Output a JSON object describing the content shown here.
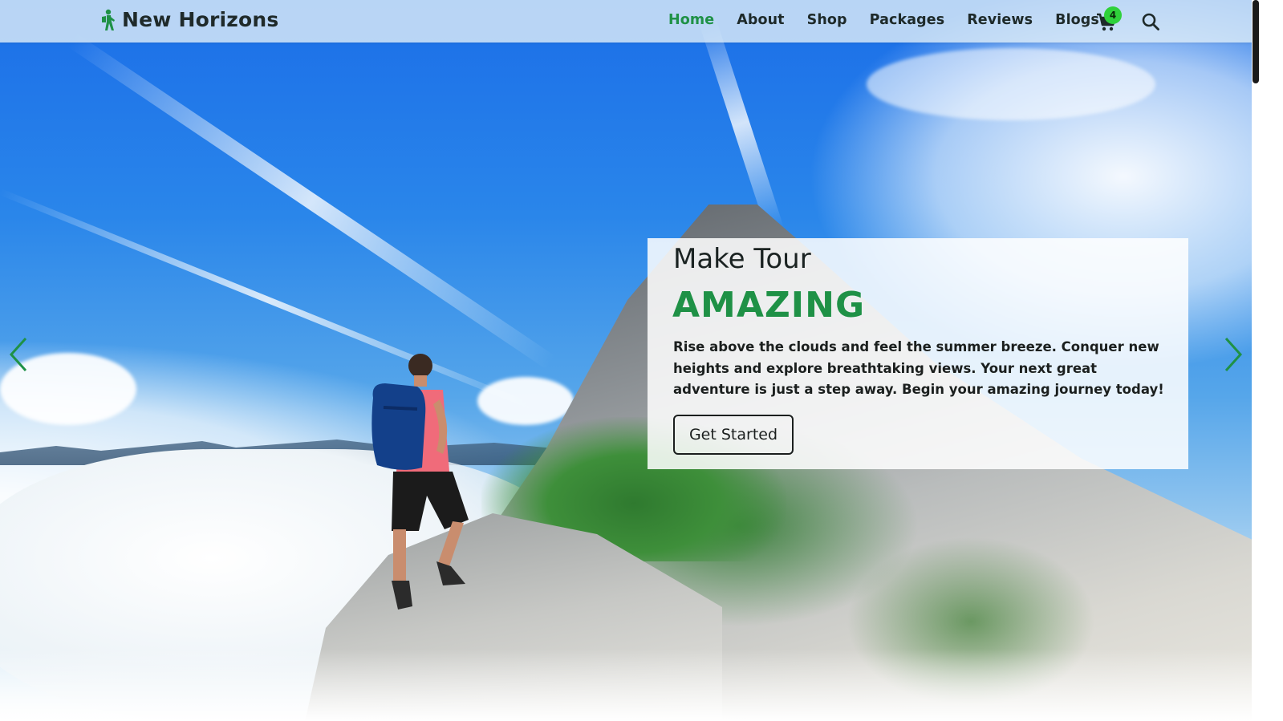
{
  "brand": {
    "name": "New Horizons",
    "icon": "hiker-icon",
    "color": "#1f9146"
  },
  "nav": {
    "items": [
      {
        "label": "Home",
        "active": true
      },
      {
        "label": "About",
        "active": false
      },
      {
        "label": "Shop",
        "active": false
      },
      {
        "label": "Packages",
        "active": false
      },
      {
        "label": "Reviews",
        "active": false
      },
      {
        "label": "Blogs",
        "active": false
      }
    ],
    "cart": {
      "icon": "cart-icon",
      "count": "4",
      "badge_color": "#2fd13b"
    },
    "search": {
      "icon": "search-icon"
    }
  },
  "hero": {
    "pretitle": "Make Tour",
    "title": "AMAZING",
    "text": "Rise above the clouds and feel the summer breeze. Conquer new heights and explore breathtaking views. Your next great adventure is just a step away. Begin your amazing journey today!",
    "button": "Get Started",
    "accent_color": "#1f9146",
    "prev_icon": "chevron-left-icon",
    "next_icon": "chevron-right-icon"
  }
}
